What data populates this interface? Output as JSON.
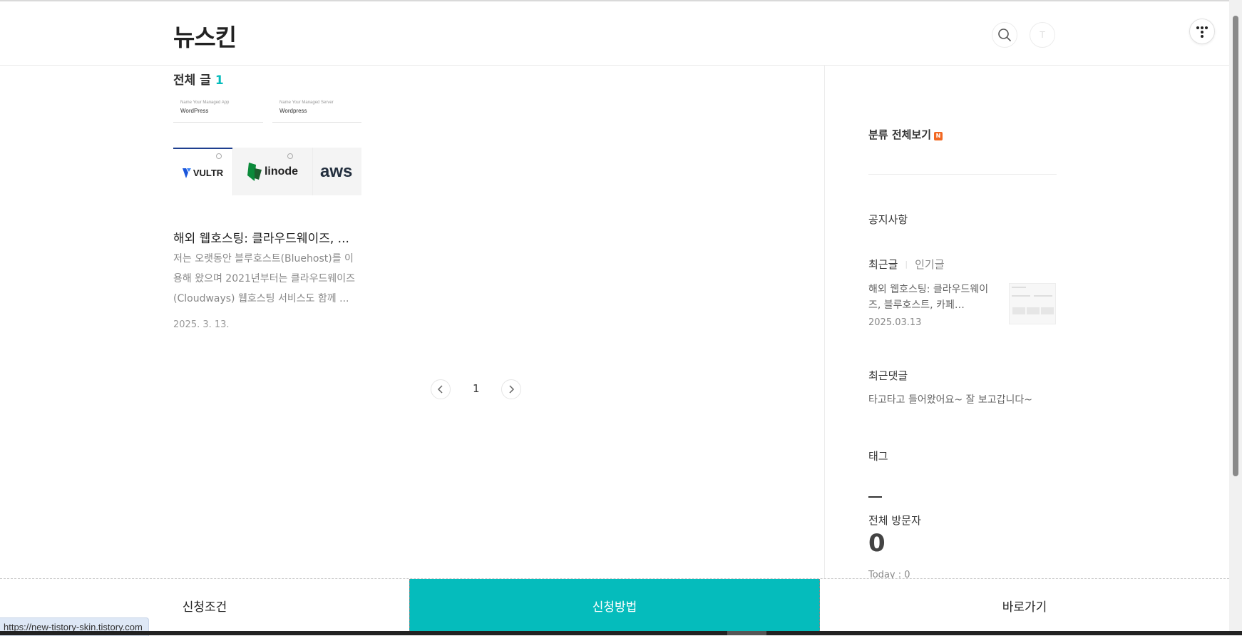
{
  "header": {
    "logo": "뉴스킨",
    "avatar_letter": "T"
  },
  "main": {
    "section_title": "전체 글",
    "count": "1",
    "thumbnail": {
      "field1_label": "Name Your Managed App",
      "field1_value": "WordPress",
      "field2_label": "Name Your Managed Server",
      "field2_value": "Wordpress",
      "providers": [
        "VULTR",
        "linode",
        "aws"
      ]
    },
    "post": {
      "title": "해외 웹호스팅: 클라우드웨이즈, ...",
      "excerpt": "저는 오랫동안 블루호스트(Bluehost)를 이용해 왔으며 2021년부터는 클라우드웨이즈(Cloudways) 웹호스팅 서비스도 함께 ...",
      "date": "2025. 3. 13."
    },
    "pagination": {
      "current": "1"
    }
  },
  "sidebar": {
    "category_title": "분류 전체보기",
    "new_badge": "N",
    "notice_title": "공지사항",
    "tab_recent": "최근글",
    "tab_popular": "인기글",
    "recent_post": {
      "title": "해외 웹호스팅: 클라우드웨이즈, 블루호스트, 카페…",
      "date": "2025.03.13"
    },
    "comments_title": "최근댓글",
    "comment": "타고타고 들어왔어요~ 잘 보고갑니다~",
    "tags_title": "태그",
    "visitors_title": "전체 방문자",
    "visitors_total": "0",
    "today": "Today : 0"
  },
  "cta": {
    "left": "신청조건",
    "center": "신청방법",
    "right": "바로가기",
    "accent_color": "#05bcbc"
  },
  "status_url": "https://new-tistory-skin.tistory.com"
}
